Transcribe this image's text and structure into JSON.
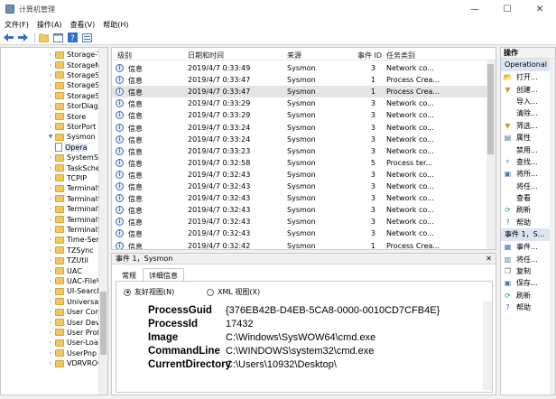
{
  "window": {
    "title": "计算机管理",
    "minimize": "—",
    "maximize": "☐",
    "close": "✕"
  },
  "menu": [
    "文件(F)",
    "操作(A)",
    "查看(V)",
    "帮助(H)"
  ],
  "toolbar_icons": [
    "back-icon",
    "forward-icon",
    "up-folder-icon",
    "show-hide-tree-icon",
    "help-icon",
    "properties-icon"
  ],
  "tree": {
    "items": [
      {
        "label": "Storage-T",
        "type": "folder",
        "expanded": false
      },
      {
        "label": "StorageM",
        "type": "folder",
        "expanded": false
      },
      {
        "label": "StorageSp",
        "type": "folder",
        "expanded": false
      },
      {
        "label": "StorageSp",
        "type": "folder",
        "expanded": false
      },
      {
        "label": "StorageSp",
        "type": "folder",
        "expanded": false
      },
      {
        "label": "StorDiag",
        "type": "folder",
        "expanded": false
      },
      {
        "label": "Store",
        "type": "folder",
        "expanded": false
      },
      {
        "label": "StorPort",
        "type": "folder",
        "expanded": false
      },
      {
        "label": "Sysmon",
        "type": "folder",
        "expanded": true
      },
      {
        "label": "Opera",
        "type": "log",
        "selected": true
      },
      {
        "label": "SystemSe",
        "type": "folder",
        "expanded": false
      },
      {
        "label": "TaskSche",
        "type": "folder",
        "expanded": false
      },
      {
        "label": "TCPIP",
        "type": "folder",
        "expanded": false
      },
      {
        "label": "TerminalS",
        "type": "folder",
        "expanded": false
      },
      {
        "label": "TerminalS",
        "type": "folder",
        "expanded": false
      },
      {
        "label": "TerminalS",
        "type": "folder",
        "expanded": false
      },
      {
        "label": "TerminalS",
        "type": "folder",
        "expanded": false
      },
      {
        "label": "TerminalS",
        "type": "folder",
        "expanded": false
      },
      {
        "label": "Time-Serv",
        "type": "folder",
        "expanded": false
      },
      {
        "label": "TZSync",
        "type": "folder",
        "expanded": false
      },
      {
        "label": "TZUtil",
        "type": "folder",
        "expanded": false
      },
      {
        "label": "UAC",
        "type": "folder",
        "expanded": false
      },
      {
        "label": "UAC-FileV",
        "type": "folder",
        "expanded": false
      },
      {
        "label": "UI-Search",
        "type": "folder",
        "expanded": false
      },
      {
        "label": "UniversalT",
        "type": "folder",
        "expanded": false
      },
      {
        "label": "User Cont",
        "type": "folder",
        "expanded": false
      },
      {
        "label": "User Devi",
        "type": "folder",
        "expanded": false
      },
      {
        "label": "User Profi",
        "type": "folder",
        "expanded": false
      },
      {
        "label": "User-Load",
        "type": "folder",
        "expanded": false
      },
      {
        "label": "UserPnp",
        "type": "folder",
        "expanded": false
      },
      {
        "label": "VDRVROC",
        "type": "folder",
        "expanded": false
      }
    ]
  },
  "events": {
    "columns": [
      "级别",
      "日期和时间",
      "来源",
      "事件 ID",
      "任务类别"
    ],
    "rows": [
      {
        "level": "信息",
        "datetime": "2019/4/7 0:33:49",
        "source": "Sysmon",
        "id": "3",
        "task": "Network co..."
      },
      {
        "level": "信息",
        "datetime": "2019/4/7 0:33:47",
        "source": "Sysmon",
        "id": "1",
        "task": "Process Crea..."
      },
      {
        "level": "信息",
        "datetime": "2019/4/7 0:33:47",
        "source": "Sysmon",
        "id": "1",
        "task": "Process Crea...",
        "selected": true
      },
      {
        "level": "信息",
        "datetime": "2019/4/7 0:33:29",
        "source": "Sysmon",
        "id": "3",
        "task": "Network co..."
      },
      {
        "level": "信息",
        "datetime": "2019/4/7 0:33:29",
        "source": "Sysmon",
        "id": "3",
        "task": "Network co..."
      },
      {
        "level": "信息",
        "datetime": "2019/4/7 0:33:24",
        "source": "Sysmon",
        "id": "3",
        "task": "Network co..."
      },
      {
        "level": "信息",
        "datetime": "2019/4/7 0:33:24",
        "source": "Sysmon",
        "id": "3",
        "task": "Network co..."
      },
      {
        "level": "信息",
        "datetime": "2019/4/7 0:33:23",
        "source": "Sysmon",
        "id": "3",
        "task": "Network co..."
      },
      {
        "level": "信息",
        "datetime": "2019/4/7 0:32:58",
        "source": "Sysmon",
        "id": "5",
        "task": "Process ter..."
      },
      {
        "level": "信息",
        "datetime": "2019/4/7 0:32:43",
        "source": "Sysmon",
        "id": "3",
        "task": "Network co..."
      },
      {
        "level": "信息",
        "datetime": "2019/4/7 0:32:43",
        "source": "Sysmon",
        "id": "3",
        "task": "Network co..."
      },
      {
        "level": "信息",
        "datetime": "2019/4/7 0:32:43",
        "source": "Sysmon",
        "id": "3",
        "task": "Network co..."
      },
      {
        "level": "信息",
        "datetime": "2019/4/7 0:32:43",
        "source": "Sysmon",
        "id": "3",
        "task": "Network co..."
      },
      {
        "level": "信息",
        "datetime": "2019/4/7 0:32:43",
        "source": "Sysmon",
        "id": "3",
        "task": "Network co..."
      },
      {
        "level": "信息",
        "datetime": "2019/4/7 0:32:43",
        "source": "Sysmon",
        "id": "3",
        "task": "Network co..."
      },
      {
        "level": "信息",
        "datetime": "2019/4/7 0:32:42",
        "source": "Sysmon",
        "id": "1",
        "task": "Process Crea..."
      }
    ]
  },
  "detail": {
    "header": "事件 1，Sysmon",
    "close": "✕",
    "tabs": [
      "常规",
      "详细信息"
    ],
    "active_tab": 1,
    "radio_friendly": "友好视图(N)",
    "radio_xml": "XML 视图(X)",
    "properties": [
      {
        "key": "ProcessGuid",
        "value": "{376EB42B-D4EB-5CA8-0000-0010CD7CFB4E}"
      },
      {
        "key": "ProcessId",
        "value": "17432"
      },
      {
        "key": "Image",
        "value": "C:\\Windows\\SysWOW64\\cmd.exe"
      },
      {
        "key": "CommandLine",
        "value": "C:\\WINDOWS\\system32\\cmd.exe"
      },
      {
        "key": "CurrentDirectory",
        "value": "C:\\Users\\10932\\Desktop\\"
      }
    ]
  },
  "actions": {
    "title": "操作",
    "section1": "Operational",
    "items1": [
      {
        "label": "打开...",
        "icon": "open-log-icon"
      },
      {
        "label": "创建...",
        "icon": "filter-icon"
      },
      {
        "label": "导入...",
        "icon": ""
      },
      {
        "label": "清除...",
        "icon": ""
      },
      {
        "label": "筛选...",
        "icon": "filter-icon"
      },
      {
        "label": "属性",
        "icon": "properties-icon"
      },
      {
        "label": "禁用...",
        "icon": ""
      },
      {
        "label": "查找...",
        "icon": "find-icon"
      },
      {
        "label": "将所...",
        "icon": "save-icon"
      },
      {
        "label": "将任...",
        "icon": ""
      },
      {
        "label": "查看",
        "icon": ""
      },
      {
        "label": "刷新",
        "icon": "refresh-icon"
      },
      {
        "label": "帮助",
        "icon": "help-icon"
      }
    ],
    "section2": "事件 1，S...",
    "items2": [
      {
        "label": "事件...",
        "icon": "event-icon"
      },
      {
        "label": "将任...",
        "icon": "attach-task-icon"
      },
      {
        "label": "复制",
        "icon": "copy-icon"
      },
      {
        "label": "保存...",
        "icon": "save-icon"
      },
      {
        "label": "刷新",
        "icon": "refresh-icon"
      },
      {
        "label": "帮助",
        "icon": "help-icon"
      }
    ]
  }
}
